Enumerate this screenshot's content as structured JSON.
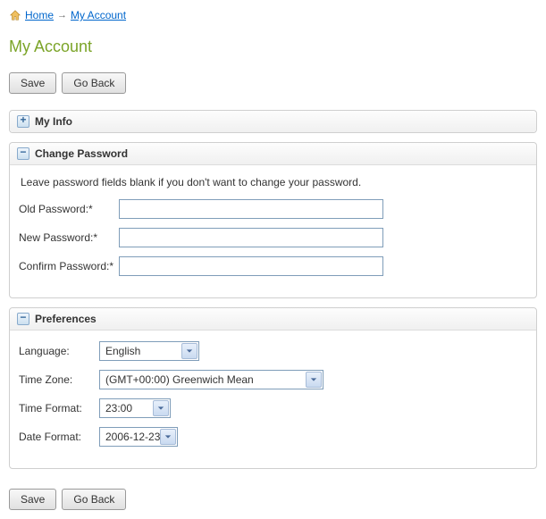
{
  "breadcrumb": {
    "home": "Home",
    "current": "My Account"
  },
  "title": "My Account",
  "actions": {
    "save": "Save",
    "go_back": "Go Back"
  },
  "sections": {
    "my_info": {
      "title": "My Info"
    },
    "change_password": {
      "title": "Change Password",
      "helper": "Leave password fields blank if you don't want to change your password.",
      "old_label": "Old Password:*",
      "new_label": "New Password:*",
      "confirm_label": "Confirm Password:*",
      "old_value": "",
      "new_value": "",
      "confirm_value": ""
    },
    "preferences": {
      "title": "Preferences",
      "language_label": "Language:",
      "language_value": "English",
      "tz_label": "Time Zone:",
      "tz_value": "(GMT+00:00) Greenwich Mean",
      "time_format_label": "Time Format:",
      "time_format_value": "23:00",
      "date_format_label": "Date Format:",
      "date_format_value": "2006-12-23"
    }
  }
}
